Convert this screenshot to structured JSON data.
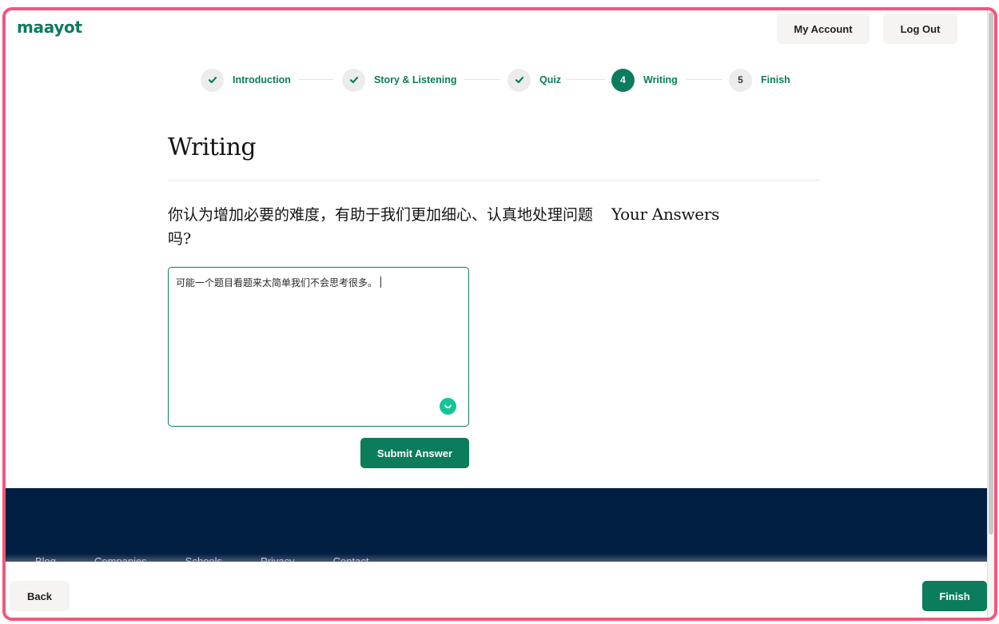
{
  "app": {
    "logo": "maayot"
  },
  "header": {
    "my_account_label": "My Account",
    "log_out_label": "Log Out"
  },
  "stepper": {
    "steps": [
      {
        "label": "Introduction",
        "state": "completed",
        "marker": "check-icon"
      },
      {
        "label": "Story & Listening",
        "state": "completed",
        "marker": "check-icon"
      },
      {
        "label": "Quiz",
        "state": "completed",
        "marker": "check-icon"
      },
      {
        "label": "Writing",
        "state": "active",
        "number": "4"
      },
      {
        "label": "Finish",
        "state": "upcoming",
        "number": "5"
      }
    ]
  },
  "main": {
    "title": "Writing",
    "question": "你认为增加必要的难度，有助于我们更加细心、认真地处理问题吗?",
    "answers_heading": "Your Answers",
    "answer_value": "可能一个题目看题来太简单我们不会思考很多。",
    "submit_label": "Submit Answer"
  },
  "footer": {
    "links": [
      "Blog",
      "Companies",
      "Schools",
      "Privacy",
      "Contact"
    ]
  },
  "bottom_bar": {
    "back_label": "Back",
    "finish_label": "Finish"
  },
  "colors": {
    "brand": "#0b7c5c",
    "frame": "#f0587c",
    "footer_bg": "#001e42",
    "grammar_badge": "#15c39a"
  }
}
